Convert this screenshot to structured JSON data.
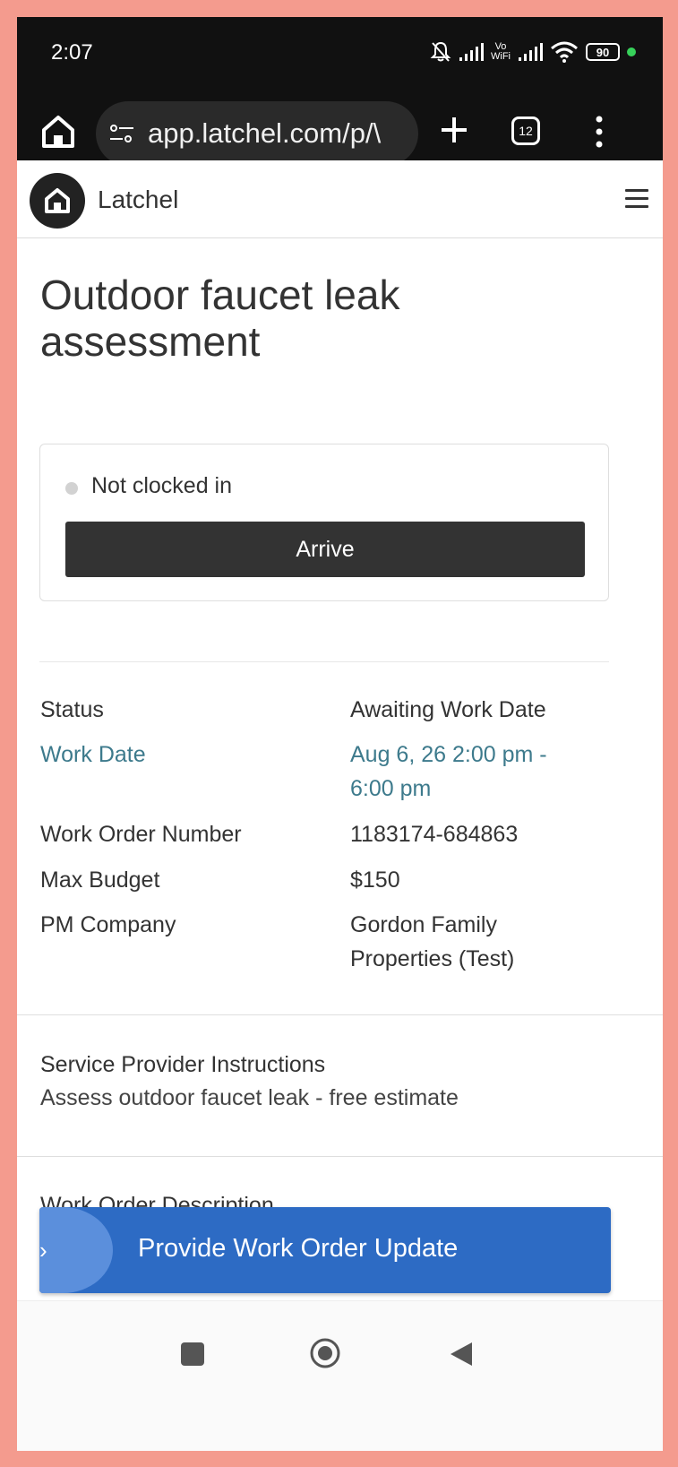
{
  "status_bar": {
    "time": "2:07",
    "vowifi_top": "Vo",
    "vowifi_bottom": "WiFi",
    "battery": "90"
  },
  "browser": {
    "url": "app.latchel.com/p/\\",
    "tab_count": "12"
  },
  "site": {
    "brand": "Latchel"
  },
  "page": {
    "title": "Outdoor faucet leak assessment",
    "clock": {
      "status": "Not clocked in",
      "arrive_label": "Arrive"
    },
    "details": [
      {
        "label": "Status",
        "value": "Awaiting Work Date",
        "link": false
      },
      {
        "label": "Work Date",
        "value": "Aug 6, 26 2:00 pm - 6:00 pm",
        "link": true
      },
      {
        "label": "Work Order Number",
        "value": "1183174-684863",
        "link": false
      },
      {
        "label": "Max Budget",
        "value": "$150",
        "link": false
      },
      {
        "label": "PM Company",
        "value": "Gordon Family Properties (Test)",
        "link": false
      }
    ],
    "instructions": {
      "label": "Service Provider Instructions",
      "value": "Assess outdoor faucet leak - free estimate"
    },
    "description_label": "Work Order Description",
    "update_button": "Provide Work Order Update"
  },
  "colors": {
    "link": "#3d7a8c",
    "update_button": "#2d6bc4",
    "arrive_button": "#333333"
  }
}
